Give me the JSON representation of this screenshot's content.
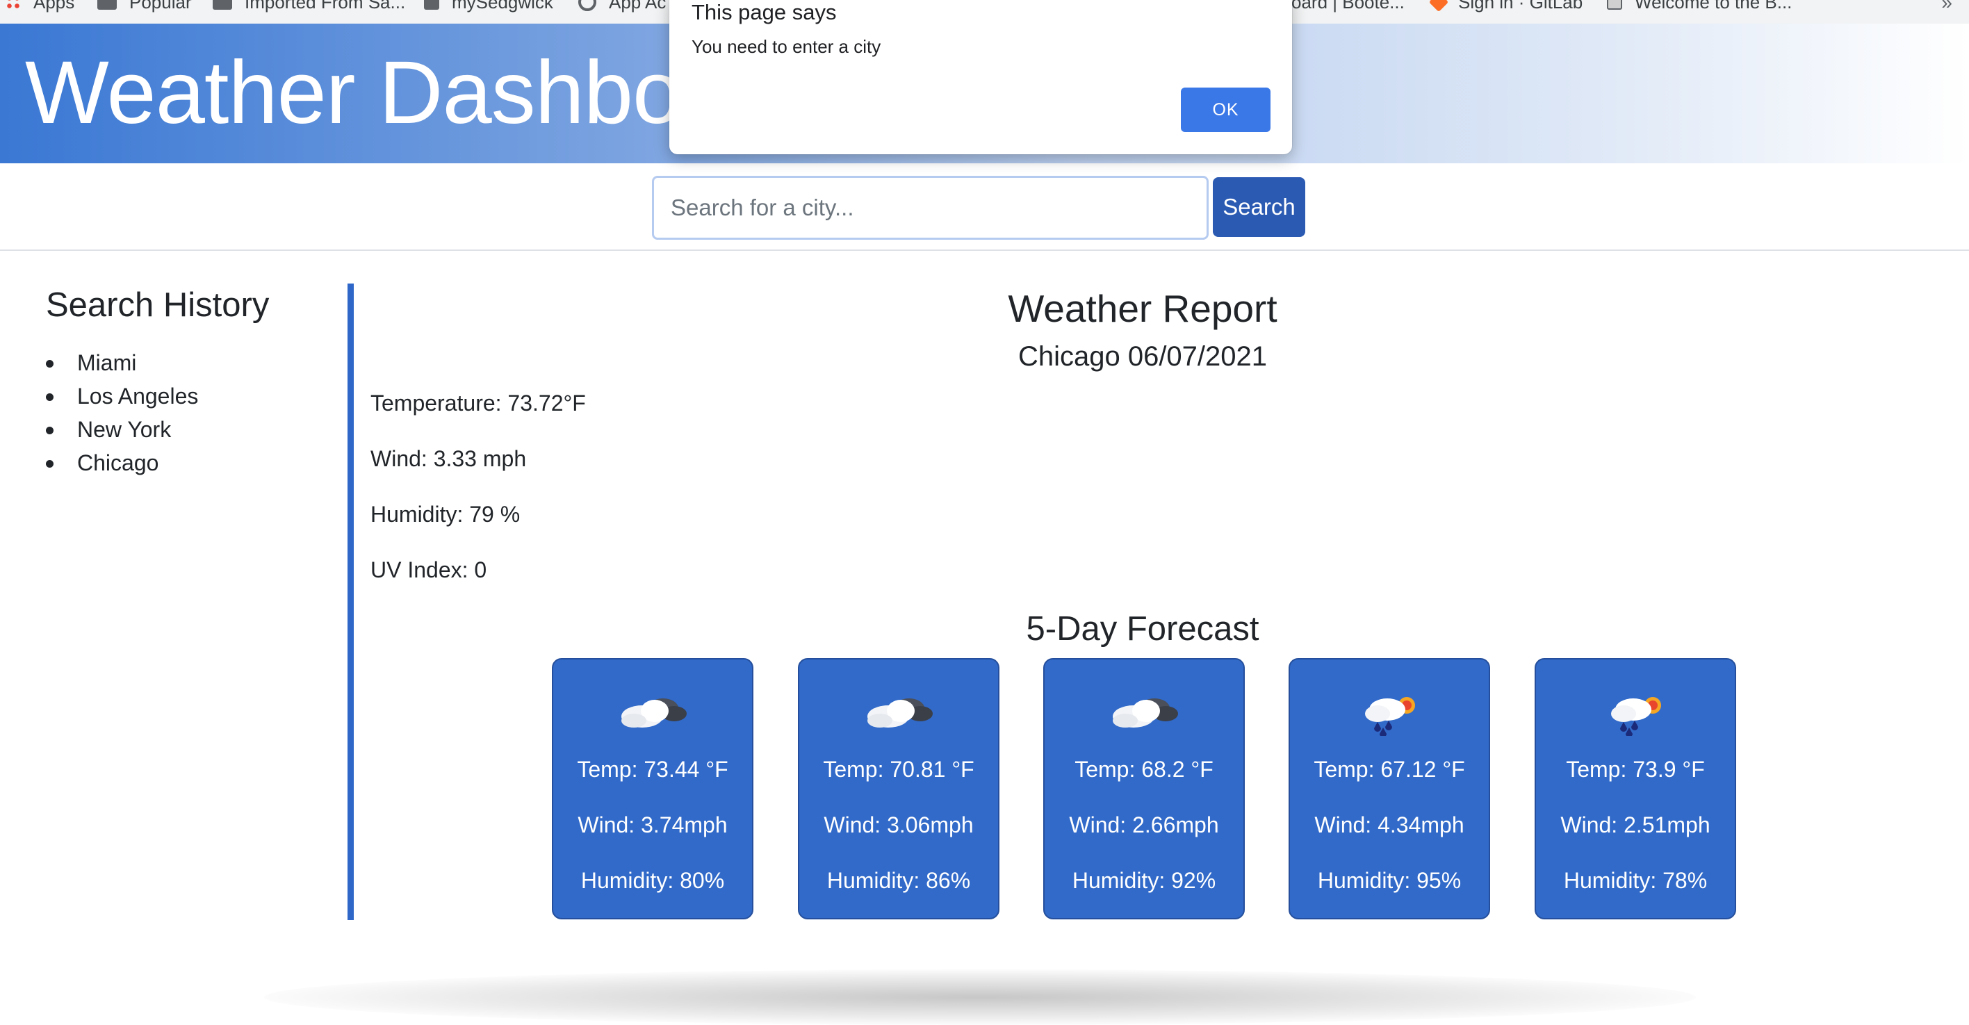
{
  "bookmarks": {
    "items": [
      {
        "label": "Apps",
        "icon": "apps-grid-icon"
      },
      {
        "label": "Popular",
        "icon": "folder-icon"
      },
      {
        "label": "Imported From Sa...",
        "icon": "folder-icon"
      },
      {
        "label": "mySedgwick",
        "icon": "document-icon"
      },
      {
        "label": "App Ac",
        "icon": "globe-icon"
      },
      {
        "label": "oard | Boote...",
        "icon": "page-icon"
      },
      {
        "label": "Sign in · GitLab",
        "icon": "gitlab-icon"
      },
      {
        "label": "Welcome to the B...",
        "icon": "document-icon"
      }
    ],
    "more": "»"
  },
  "header": {
    "title": "Weather Dashboard"
  },
  "search": {
    "placeholder": "Search for a city...",
    "value": "",
    "button_label": "Search"
  },
  "sidebar": {
    "title": "Search History",
    "items": [
      "Miami",
      "Los Angeles",
      "New York",
      "Chicago"
    ]
  },
  "report": {
    "title": "Weather Report",
    "subtitle": "Chicago 06/07/2021",
    "temperature": "Temperature: 73.72°F",
    "wind": "Wind: 3.33 mph",
    "humidity": "Humidity: 79 %",
    "uv": "UV Index: 0"
  },
  "forecast": {
    "title": "5-Day Forecast",
    "days": [
      {
        "icon": "broken-clouds-icon",
        "temp": "Temp: 73.44 °F",
        "wind": "Wind: 3.74mph",
        "humidity": "Humidity: 80%"
      },
      {
        "icon": "broken-clouds-icon",
        "temp": "Temp: 70.81 °F",
        "wind": "Wind: 3.06mph",
        "humidity": "Humidity: 86%"
      },
      {
        "icon": "broken-clouds-icon",
        "temp": "Temp: 68.2 °F",
        "wind": "Wind: 2.66mph",
        "humidity": "Humidity: 92%"
      },
      {
        "icon": "rain-sun-icon",
        "temp": "Temp: 67.12 °F",
        "wind": "Wind: 4.34mph",
        "humidity": "Humidity: 95%"
      },
      {
        "icon": "rain-sun-icon",
        "temp": "Temp: 73.9 °F",
        "wind": "Wind: 2.51mph",
        "humidity": "Humidity: 78%"
      }
    ]
  },
  "alert": {
    "title": "This page says",
    "message": "You need to enter a city",
    "ok_label": "OK"
  },
  "colors": {
    "header_start": "#3a78d4",
    "card_bg": "#316ac9",
    "search_button": "#2b5ab3",
    "divider": "#2f67c9",
    "alert_button": "#3b78e7"
  }
}
